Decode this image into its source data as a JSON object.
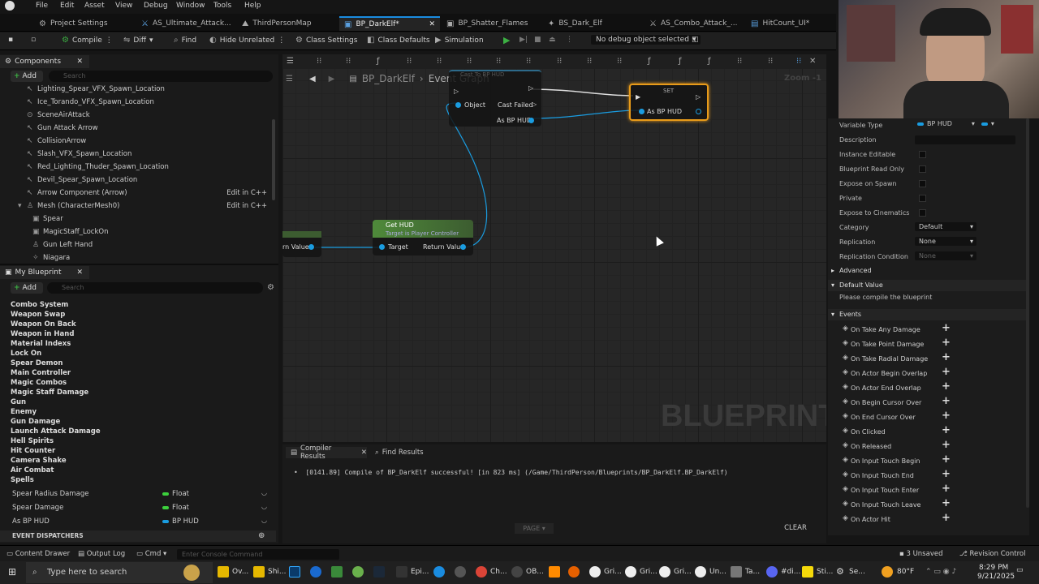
{
  "menu": [
    "File",
    "Edit",
    "Asset",
    "View",
    "Debug",
    "Window",
    "Tools",
    "Help"
  ],
  "tabs": [
    "Project Settings",
    "AS_Ultimate_Attack...",
    "ThirdPersonMap",
    "BP_DarkElf*",
    "BP_Shatter_Flames",
    "BS_Dark_Elf",
    "AS_Combo_Attack_...",
    "HitCount_UI*"
  ],
  "toolbar": {
    "compile": "Compile",
    "diff": "Diff",
    "find": "Find",
    "hide_unrelated": "Hide Unrelated",
    "class_settings": "Class Settings",
    "class_defaults": "Class Defaults",
    "simulation": "Simulation",
    "debug_select": "No debug object selected"
  },
  "components": {
    "title": "Components",
    "add": "Add",
    "search_placeholder": "Search",
    "items": [
      "Lighting_Spear_VFX_Spawn_Location",
      "Ice_Torando_VFX_Spawn_Location",
      "SceneAirAttack",
      "Gun Attack Arrow",
      "CollisionArrow",
      "Slash_VFX_Spawn_Location",
      "Red_Lighting_Thuder_Spawn_Location",
      "Devil_Spear_Spawn_Location",
      "Arrow Component (Arrow)",
      "Mesh (CharacterMesh0)",
      "Spear",
      "MagicStaff_LockOn",
      "Gun Left Hand",
      "Niagara"
    ],
    "edit_cpp": "Edit in C++"
  },
  "my_blueprint": {
    "title": "My Blueprint",
    "add": "Add",
    "search_placeholder": "Search",
    "categories": [
      "Combo System",
      "Weapon Swap",
      "Weapon On Back",
      "Weapon in Hand",
      "Material Indexs",
      "Lock On",
      "Spear Demon",
      "Main Controller",
      "Magic Combos",
      "Magic Staff Damage",
      "Gun",
      "Enemy",
      "Gun Damage",
      "Launch Attack Damage",
      "Hell Spirits",
      "Hit Counter",
      "Camera Shake",
      "Air Combat",
      "Spells"
    ],
    "variables": [
      {
        "name": "Spear Radius Damage",
        "type": "Float",
        "color": "#3cd03c"
      },
      {
        "name": "Spear Damage",
        "type": "Float",
        "color": "#3cd03c"
      },
      {
        "name": "As BP HUD",
        "type": "BP HUD",
        "color": "#1a9ce0"
      }
    ],
    "event_dispatchers": "EVENT DISPATCHERS"
  },
  "graph": {
    "breadcrumb": "BP_DarkElf",
    "title": "Event Graph",
    "zoom": "Zoom -1",
    "watermark": "BLUEPRINT",
    "cast_node_title": "Cast To BP HUD",
    "cast_object": "Object",
    "cast_failed": "Cast Failed",
    "cast_as": "As BP HUD",
    "set_node": "SET",
    "set_pin": "As BP HUD",
    "gethud_title": "Get HUD",
    "gethud_sub": "Target is Player Controller",
    "gethud_target": "Target",
    "gethud_return": "Return Value",
    "left_return": "rn Value"
  },
  "results": {
    "tab1": "Compiler Results",
    "tab2": "Find Results",
    "log": "[0141.89] Compile of BP_DarkElf successful! [in 823 ms] (/Game/ThirdPerson/Blueprints/BP_DarkElf.BP_DarkElf)",
    "page": "PAGE",
    "clear": "CLEAR"
  },
  "details": {
    "variable_type_label": "Variable Type",
    "variable_type": "BP HUD",
    "description": "Description",
    "instance_editable": "Instance Editable",
    "bp_read_only": "Blueprint Read Only",
    "expose_spawn": "Expose on Spawn",
    "private": "Private",
    "expose_cinematics": "Expose to Cinematics",
    "category_label": "Category",
    "category": "Default",
    "replication_label": "Replication",
    "replication": "None",
    "replication_cond_label": "Replication Condition",
    "replication_cond": "None",
    "advanced": "Advanced",
    "default_value": "Default Value",
    "compile_msg": "Please compile the blueprint",
    "events_header": "Events",
    "events": [
      "On Take Any Damage",
      "On Take Point Damage",
      "On Take Radial Damage",
      "On Actor Begin Overlap",
      "On Actor End Overlap",
      "On Begin Cursor Over",
      "On End Cursor Over",
      "On Clicked",
      "On Released",
      "On Input Touch Begin",
      "On Input Touch End",
      "On Input Touch Enter",
      "On Input Touch Leave",
      "On Actor Hit"
    ]
  },
  "statusbar": {
    "content_drawer": "Content Drawer",
    "output_log": "Output Log",
    "cmd": "Cmd",
    "console_placeholder": "Enter Console Command",
    "unsaved": "3 Unsaved",
    "revision": "Revision Control"
  },
  "taskbar": {
    "search": "Type here to search",
    "weather": "80°F",
    "time": "8:29 PM",
    "date": "9/21/2025",
    "apps": [
      "Ov...",
      "Shi...",
      "Epi...",
      "Ch...",
      "OB...",
      "Gri...",
      "Gri...",
      "Gri...",
      "Un...",
      "Ta...",
      "#di...",
      "Sti...",
      "Se..."
    ]
  }
}
